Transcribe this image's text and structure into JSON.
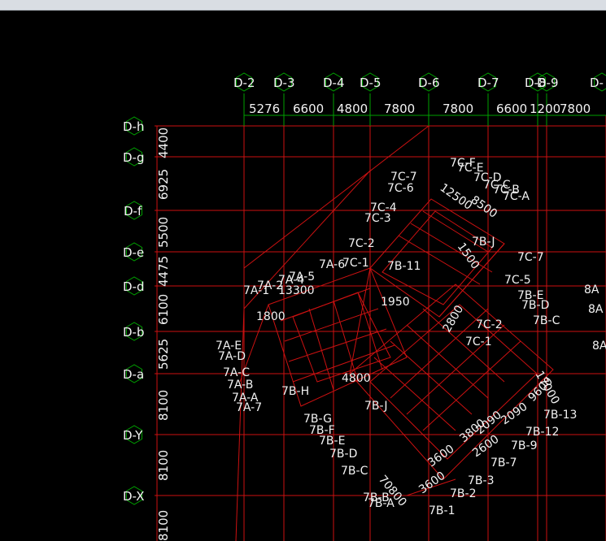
{
  "colors": {
    "background": "#000000",
    "grid_line": "#cc1111",
    "axis_line": "#00a000",
    "bubble": "#00a000",
    "text": "#f2f2f2"
  },
  "icons": {
    "axis_bubble": "hexagon-axis-marker-icon"
  },
  "column_axes": [
    "D-2",
    "D-3",
    "D-4",
    "D-5",
    "D-6",
    "D-7",
    "D-8",
    "D-9",
    "D-"
  ],
  "column_dims": [
    "5276",
    "6600",
    "4800",
    "7800",
    "7800",
    "6600",
    "1200",
    "7800"
  ],
  "row_axes": [
    "D-h",
    "D-g",
    "D-f",
    "D-e",
    "D-d",
    "D-b",
    "D-a",
    "D-Y",
    "D-X"
  ],
  "row_dims": [
    "4400",
    "6925",
    "5500",
    "4475",
    "6100",
    "5625",
    "8100",
    "8100",
    "8100"
  ],
  "plan_labels": [
    "7C-7",
    "7C-6",
    "7C-4",
    "7C-3",
    "7C-2",
    "7C-1",
    "7A-6",
    "7A-5",
    "7A-4",
    "7A-2",
    "7A-1",
    "7A-E",
    "7A-D",
    "7A-C",
    "7A-B",
    "7A-A",
    "7A-7",
    "7B-J",
    "7B-H",
    "7B-G",
    "7B-F",
    "7B-E",
    "7B-D",
    "7B-C",
    "7B-B",
    "7B-A",
    "7B-1",
    "7B-2",
    "7B-3",
    "7B-7",
    "7B-9",
    "7B-12",
    "7B-13",
    "7B-11",
    "7C-F",
    "7C-E",
    "7C-D",
    "7C-C",
    "7C-B",
    "7C-A",
    "7B-J",
    "7C-7",
    "7C-5",
    "7B-E",
    "7B-D",
    "7B-C",
    "7C-2",
    "7C-1",
    "8A",
    "8A",
    "8A",
    "13300",
    "1800",
    "1500",
    "1950",
    "2800",
    "3600",
    "4800",
    "12500",
    "8500",
    "17000",
    "2090",
    "3800",
    "2090",
    "2600",
    "3600",
    "9600",
    "70800"
  ]
}
